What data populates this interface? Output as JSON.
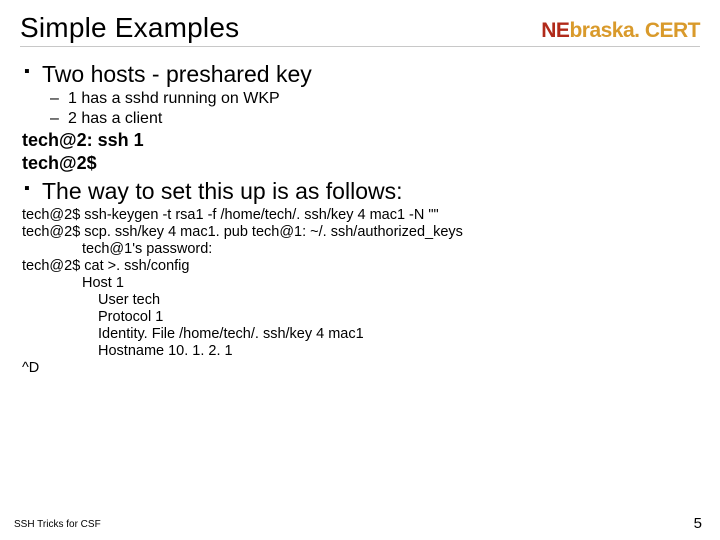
{
  "header": {
    "title": "Simple Examples",
    "brand_ne": "NE",
    "brand_rest": "braska. CERT"
  },
  "bullets": {
    "b1": "Two hosts - preshared key",
    "b1_sub1": "1 has a sshd running on WKP",
    "b1_sub2": "2 has a client",
    "b2": "The way to set this up is as follows:"
  },
  "example": {
    "line1": "tech@2: ssh 1",
    "line2": "tech@2$"
  },
  "setup": {
    "l1": "tech@2$ ssh-keygen -t rsa1 -f /home/tech/. ssh/key 4 mac1 -N \"\"",
    "l2": "tech@2$ scp. ssh/key 4 mac1. pub tech@1: ~/. ssh/authorized_keys",
    "l3": "tech@1's password:",
    "l4": "tech@2$ cat >. ssh/config",
    "l5": "Host 1",
    "l6": "User tech",
    "l7": "Protocol 1",
    "l8": "Identity. File /home/tech/. ssh/key 4 mac1",
    "l9": "Hostname 10. 1. 2. 1",
    "l10": "^D"
  },
  "footer": {
    "left": "SSH Tricks for CSF",
    "right": "5"
  }
}
